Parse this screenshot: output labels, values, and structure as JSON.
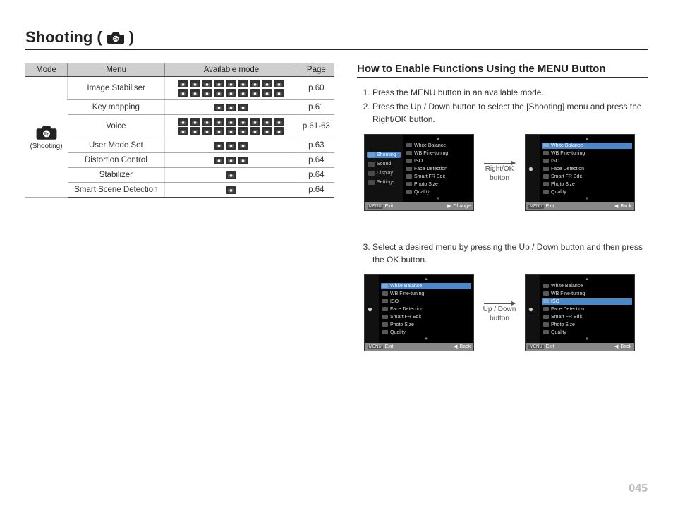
{
  "title_prefix": "Shooting (",
  "title_suffix": ")",
  "page_number": "045",
  "table": {
    "headers": {
      "mode": "Mode",
      "menu": "Menu",
      "available": "Available mode",
      "page": "Page"
    },
    "mode_label": "(Shooting)",
    "rows": [
      {
        "menu": "Image Stabiliser",
        "icons": 18,
        "page": "p.60"
      },
      {
        "menu": "Key mapping",
        "icons": 3,
        "page": "p.61"
      },
      {
        "menu": "Voice",
        "icons": 18,
        "page": "p.61-63"
      },
      {
        "menu": "User Mode Set",
        "icons": 3,
        "page": "p.63"
      },
      {
        "menu": "Distortion Control",
        "icons": 3,
        "page": "p.64"
      },
      {
        "menu": "Stabilizer",
        "icons": 1,
        "page": "p.64"
      },
      {
        "menu": "Smart Scene Detection",
        "icons": 1,
        "page": "p.64"
      }
    ]
  },
  "section_heading": "How to Enable Functions Using the MENU Button",
  "steps12": [
    "Press the MENU button in an available mode.",
    "Press the Up / Down button to select the [Shooting] menu and press the Right/OK button."
  ],
  "arrow1": {
    "label1": "Right/OK",
    "label2": "button"
  },
  "step3": "Select a desired menu by pressing the Up / Down button and then press the OK button.",
  "arrow2": {
    "label1": "Up / Down",
    "label2": "button"
  },
  "lcd": {
    "side": [
      {
        "label": "Shooting"
      },
      {
        "label": "Sound"
      },
      {
        "label": "Display"
      },
      {
        "label": "Settings"
      }
    ],
    "items": [
      "White Balance",
      "WB Fine-tuning",
      "ISO",
      "Face Detection",
      "Smart FR Edit",
      "Photo Size",
      "Quality"
    ],
    "foot_exit": "Exit",
    "foot_change": "Change",
    "foot_back": "Back",
    "btn_menu": "MENU"
  }
}
